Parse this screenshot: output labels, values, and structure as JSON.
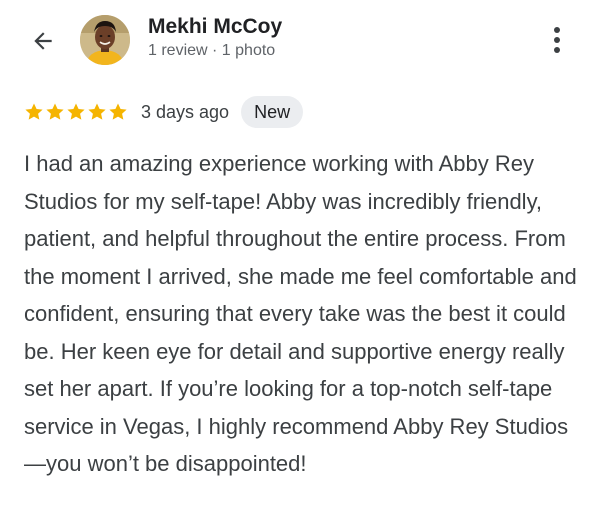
{
  "header": {
    "back_icon": "arrow-left-icon",
    "more_icon": "more-vertical-icon",
    "reviewer": {
      "name": "Mekhi McCoy",
      "meta": "1 review · 1 photo"
    }
  },
  "review": {
    "rating": 5,
    "rating_max": 5,
    "star_color": "#f5b400",
    "time_ago": "3 days ago",
    "badge": "New",
    "text": "I had an amazing experience working with Abby Rey Studios for my self-tape! Abby was incredibly friendly, patient, and helpful throughout the entire process. From the moment I arrived, she made me feel comfortable and confident, ensuring that every take was the best it could be. Her keen eye for detail and supportive energy really set her apart. If you’re looking for a top-notch self-tape service in Vegas, I highly recommend Abby Rey Studios—you won’t be disappointed!"
  }
}
